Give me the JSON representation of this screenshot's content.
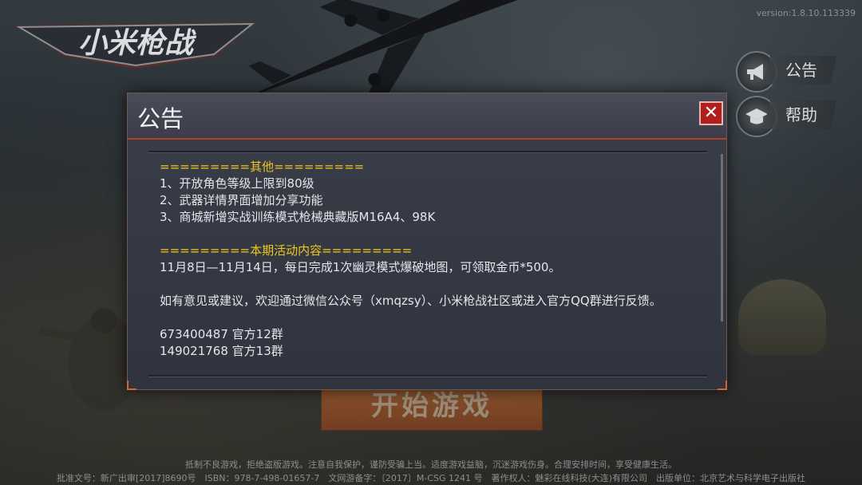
{
  "version": "version:1.8.10.113339",
  "logo_text": "小米枪战",
  "side_buttons": [
    {
      "label": "公告",
      "icon": "megaphone-icon"
    },
    {
      "label": "帮助",
      "icon": "graduation-cap-icon"
    }
  ],
  "start_button": "开始游戏",
  "dialog": {
    "title": "公告",
    "close_symbol": "✕",
    "sections": {
      "other_heading": "=========其他=========",
      "other_items": [
        "1、开放角色等级上限到80级",
        "2、武器详情界面增加分享功能",
        "3、商城新增实战训练模式枪械典藏版M16A4、98K"
      ],
      "event_heading": "=========本期活动内容=========",
      "event_text": "11月8日—11月14日，每日完成1次幽灵模式爆破地图，可领取金币*500。",
      "feedback_text": "如有意见或建议，欢迎通过微信公众号（xmqzsy）、小米枪战社区或进入官方QQ群进行反馈。",
      "groups": [
        "673400487 官方12群",
        "149021768 官方13群"
      ]
    }
  },
  "legal": {
    "line1": "抵制不良游戏，拒绝盗版游戏。注意自我保护，谨防受骗上当。适度游戏益脑，沉迷游戏伤身。合理安排时间，享受健康生活。",
    "line2": "批准文号：新广出审[2017]8690号　ISBN：978-7-498-01657-7　文网游备字：〔2017〕M-CSG 1241 号　著作权人：魅彩在线科技(大连)有限公司　出版单位：北京艺术与科学电子出版社"
  },
  "colors": {
    "accent_yellow": "#f0c61e",
    "close_red": "#b01e1e",
    "header_border": "#b2401f"
  }
}
